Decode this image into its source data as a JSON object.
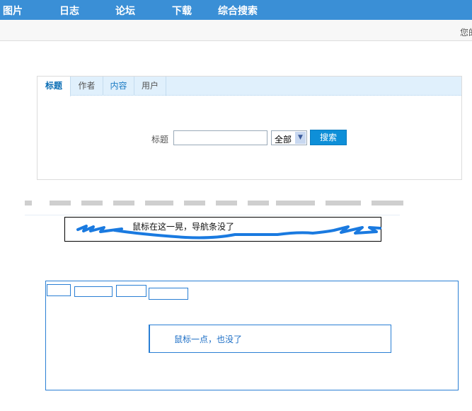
{
  "topnav": {
    "items": [
      "图片",
      "日志",
      "论坛",
      "下载",
      "综合搜索"
    ],
    "color": "#3a8fd6"
  },
  "subbar": {
    "welcome": "您的"
  },
  "search": {
    "tabs": [
      "标题",
      "作者",
      "内容",
      "用户"
    ],
    "field_label": "标题",
    "query_value": "",
    "scope_selected": "全部",
    "submit_label": "搜索"
  },
  "demo": {
    "hover_note": "鼠标在这一晃，导航条没了",
    "click_note": "鼠标一点，也没了"
  }
}
